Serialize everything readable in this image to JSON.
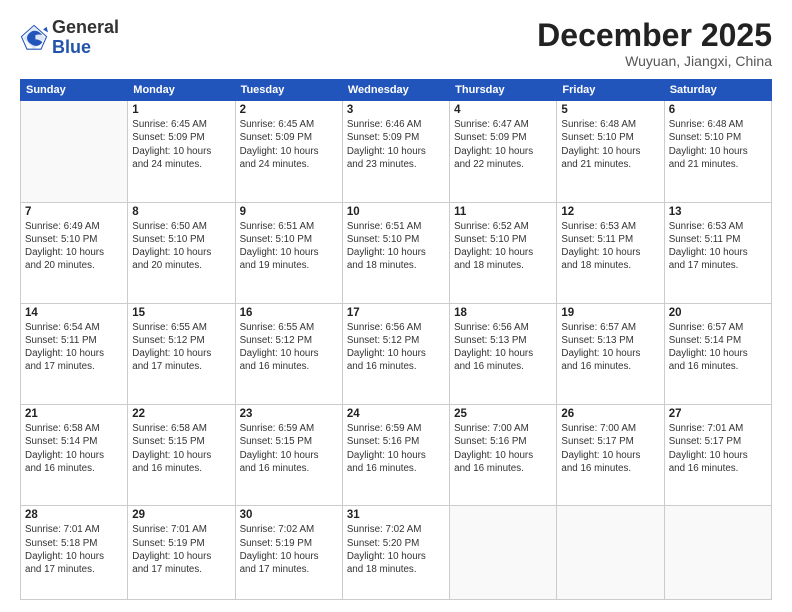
{
  "logo": {
    "general": "General",
    "blue": "Blue"
  },
  "header": {
    "month": "December 2025",
    "location": "Wuyuan, Jiangxi, China"
  },
  "weekdays": [
    "Sunday",
    "Monday",
    "Tuesday",
    "Wednesday",
    "Thursday",
    "Friday",
    "Saturday"
  ],
  "weeks": [
    [
      {
        "day": "",
        "info": ""
      },
      {
        "day": "1",
        "info": "Sunrise: 6:45 AM\nSunset: 5:09 PM\nDaylight: 10 hours\nand 24 minutes."
      },
      {
        "day": "2",
        "info": "Sunrise: 6:45 AM\nSunset: 5:09 PM\nDaylight: 10 hours\nand 24 minutes."
      },
      {
        "day": "3",
        "info": "Sunrise: 6:46 AM\nSunset: 5:09 PM\nDaylight: 10 hours\nand 23 minutes."
      },
      {
        "day": "4",
        "info": "Sunrise: 6:47 AM\nSunset: 5:09 PM\nDaylight: 10 hours\nand 22 minutes."
      },
      {
        "day": "5",
        "info": "Sunrise: 6:48 AM\nSunset: 5:10 PM\nDaylight: 10 hours\nand 21 minutes."
      },
      {
        "day": "6",
        "info": "Sunrise: 6:48 AM\nSunset: 5:10 PM\nDaylight: 10 hours\nand 21 minutes."
      }
    ],
    [
      {
        "day": "7",
        "info": "Sunrise: 6:49 AM\nSunset: 5:10 PM\nDaylight: 10 hours\nand 20 minutes."
      },
      {
        "day": "8",
        "info": "Sunrise: 6:50 AM\nSunset: 5:10 PM\nDaylight: 10 hours\nand 20 minutes."
      },
      {
        "day": "9",
        "info": "Sunrise: 6:51 AM\nSunset: 5:10 PM\nDaylight: 10 hours\nand 19 minutes."
      },
      {
        "day": "10",
        "info": "Sunrise: 6:51 AM\nSunset: 5:10 PM\nDaylight: 10 hours\nand 18 minutes."
      },
      {
        "day": "11",
        "info": "Sunrise: 6:52 AM\nSunset: 5:10 PM\nDaylight: 10 hours\nand 18 minutes."
      },
      {
        "day": "12",
        "info": "Sunrise: 6:53 AM\nSunset: 5:11 PM\nDaylight: 10 hours\nand 18 minutes."
      },
      {
        "day": "13",
        "info": "Sunrise: 6:53 AM\nSunset: 5:11 PM\nDaylight: 10 hours\nand 17 minutes."
      }
    ],
    [
      {
        "day": "14",
        "info": "Sunrise: 6:54 AM\nSunset: 5:11 PM\nDaylight: 10 hours\nand 17 minutes."
      },
      {
        "day": "15",
        "info": "Sunrise: 6:55 AM\nSunset: 5:12 PM\nDaylight: 10 hours\nand 17 minutes."
      },
      {
        "day": "16",
        "info": "Sunrise: 6:55 AM\nSunset: 5:12 PM\nDaylight: 10 hours\nand 16 minutes."
      },
      {
        "day": "17",
        "info": "Sunrise: 6:56 AM\nSunset: 5:12 PM\nDaylight: 10 hours\nand 16 minutes."
      },
      {
        "day": "18",
        "info": "Sunrise: 6:56 AM\nSunset: 5:13 PM\nDaylight: 10 hours\nand 16 minutes."
      },
      {
        "day": "19",
        "info": "Sunrise: 6:57 AM\nSunset: 5:13 PM\nDaylight: 10 hours\nand 16 minutes."
      },
      {
        "day": "20",
        "info": "Sunrise: 6:57 AM\nSunset: 5:14 PM\nDaylight: 10 hours\nand 16 minutes."
      }
    ],
    [
      {
        "day": "21",
        "info": "Sunrise: 6:58 AM\nSunset: 5:14 PM\nDaylight: 10 hours\nand 16 minutes."
      },
      {
        "day": "22",
        "info": "Sunrise: 6:58 AM\nSunset: 5:15 PM\nDaylight: 10 hours\nand 16 minutes."
      },
      {
        "day": "23",
        "info": "Sunrise: 6:59 AM\nSunset: 5:15 PM\nDaylight: 10 hours\nand 16 minutes."
      },
      {
        "day": "24",
        "info": "Sunrise: 6:59 AM\nSunset: 5:16 PM\nDaylight: 10 hours\nand 16 minutes."
      },
      {
        "day": "25",
        "info": "Sunrise: 7:00 AM\nSunset: 5:16 PM\nDaylight: 10 hours\nand 16 minutes."
      },
      {
        "day": "26",
        "info": "Sunrise: 7:00 AM\nSunset: 5:17 PM\nDaylight: 10 hours\nand 16 minutes."
      },
      {
        "day": "27",
        "info": "Sunrise: 7:01 AM\nSunset: 5:17 PM\nDaylight: 10 hours\nand 16 minutes."
      }
    ],
    [
      {
        "day": "28",
        "info": "Sunrise: 7:01 AM\nSunset: 5:18 PM\nDaylight: 10 hours\nand 17 minutes."
      },
      {
        "day": "29",
        "info": "Sunrise: 7:01 AM\nSunset: 5:19 PM\nDaylight: 10 hours\nand 17 minutes."
      },
      {
        "day": "30",
        "info": "Sunrise: 7:02 AM\nSunset: 5:19 PM\nDaylight: 10 hours\nand 17 minutes."
      },
      {
        "day": "31",
        "info": "Sunrise: 7:02 AM\nSunset: 5:20 PM\nDaylight: 10 hours\nand 18 minutes."
      },
      {
        "day": "",
        "info": ""
      },
      {
        "day": "",
        "info": ""
      },
      {
        "day": "",
        "info": ""
      }
    ]
  ]
}
